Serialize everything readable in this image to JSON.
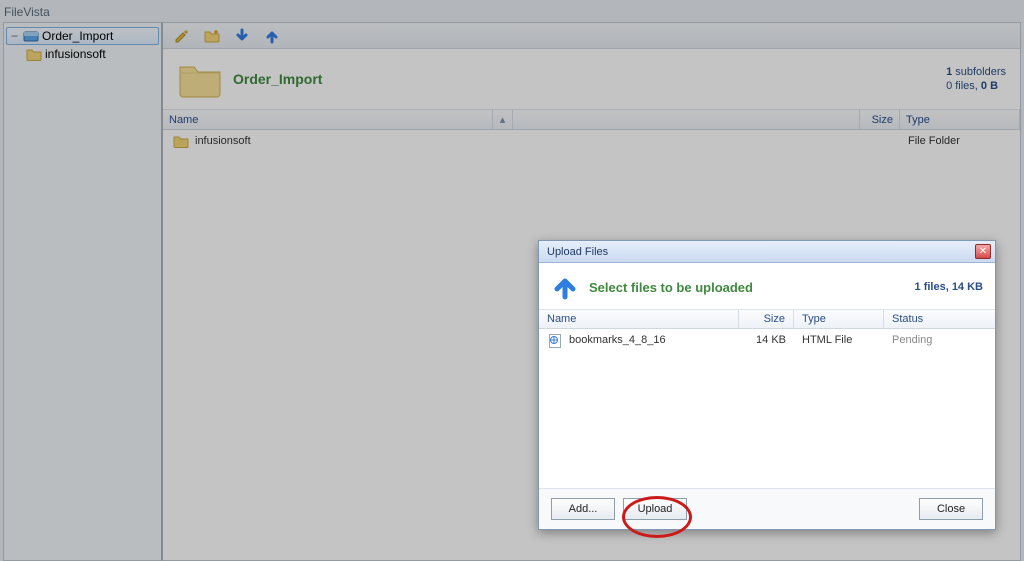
{
  "app": {
    "title": "FileVista"
  },
  "tree": {
    "root": {
      "label": "Order_Import"
    },
    "children": [
      {
        "label": "infusionsoft"
      }
    ]
  },
  "folderHeader": {
    "name": "Order_Import",
    "stats_subfolders_count": "1",
    "stats_subfolders_word": " subfolders",
    "stats_files": "0 files, ",
    "stats_size": "0 B"
  },
  "grid": {
    "columns": {
      "name": "Name",
      "size": "Size",
      "type": "Type"
    },
    "rows": [
      {
        "name": "infusionsoft",
        "size": "",
        "type": "File Folder"
      }
    ]
  },
  "dialog": {
    "windowTitle": "Upload Files",
    "title": "Select files to be uploaded",
    "stats": "1 files, 14 KB",
    "columns": {
      "name": "Name",
      "size": "Size",
      "type": "Type",
      "status": "Status"
    },
    "rows": [
      {
        "name": "bookmarks_4_8_16",
        "size": "14 KB",
        "type": "HTML File",
        "status": "Pending"
      }
    ],
    "buttons": {
      "add": "Add...",
      "upload": "Upload",
      "close": "Close"
    }
  }
}
